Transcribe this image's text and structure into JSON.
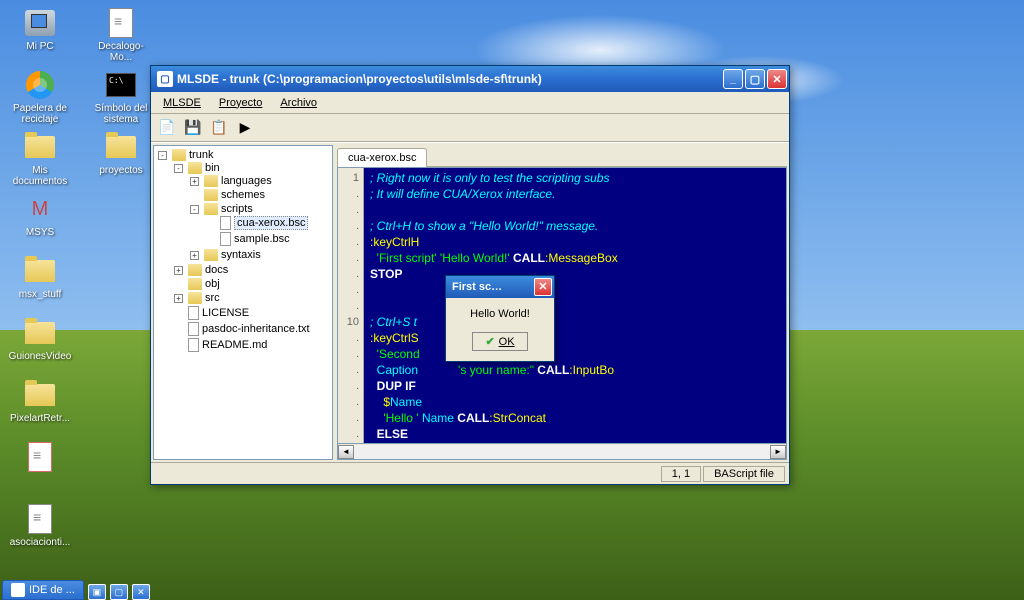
{
  "desktop": {
    "icons": [
      {
        "name": "mi-pc",
        "label": "Mi PC",
        "type": "pc"
      },
      {
        "name": "papelera",
        "label": "Papelera de reciclaje",
        "type": "recycle"
      },
      {
        "name": "mis-docs",
        "label": "Mis documentos",
        "type": "folder"
      },
      {
        "name": "msys",
        "label": "MSYS",
        "type": "app"
      },
      {
        "name": "msx-stuff",
        "label": "msx_stuff",
        "type": "folder"
      },
      {
        "name": "guiones",
        "label": "GuionesVideo",
        "type": "folder"
      },
      {
        "name": "pixelart",
        "label": "PixelartRetr...",
        "type": "folder"
      },
      {
        "name": "charla",
        "label": "",
        "type": "doc"
      },
      {
        "name": "asociacion",
        "label": "asociacionti...",
        "type": "doc"
      },
      {
        "name": "decalogo",
        "label": "Decalogo-Mo...",
        "type": "doc"
      },
      {
        "name": "simbolo",
        "label": "Símbolo del sistema",
        "type": "cmd"
      },
      {
        "name": "proyectos",
        "label": "proyectos",
        "type": "folder"
      }
    ]
  },
  "window": {
    "title": "MLSDE - trunk (C:\\programacion\\proyectos\\utils\\mlsde-sf\\trunk)",
    "menus": [
      "MLSDE",
      "Proyecto",
      "Archivo"
    ],
    "tree": {
      "root": "trunk",
      "bin": "bin",
      "languages": "languages",
      "schemes": "schemes",
      "scripts": "scripts",
      "cua": "cua-xerox.bsc",
      "sample": "sample.bsc",
      "syntaxis": "syntaxis",
      "docs": "docs",
      "obj": "obj",
      "src": "src",
      "license": "LICENSE",
      "pasdoc": "pasdoc-inheritance.txt",
      "readme": "README.md"
    },
    "tab": "cua-xerox.bsc",
    "gutter": {
      "l1": "1",
      "l10": "10"
    },
    "code": {
      "l1": "; Right now it is only to test the scripting subs",
      "l2": "; It will define CUA/Xerox interface.",
      "l3": "",
      "l4": "; Ctrl+H to show a \"Hello World!\" message.",
      "l5": ":keyCtrlH",
      "l6a": "  'First script'",
      "l6b": " 'Hello World!'",
      "l6c": " CALL",
      "l6d": ":MessageBox",
      "l7": "STOP",
      "l8": "",
      "l9": "",
      "l10a": "; Ctrl+S t",
      "l11": ":keyCtrlS",
      "l12a": "  'Second",
      "l12b": "ion",
      "l13a": "  Caption",
      "l13b": "'s your name:\"",
      "l13c": " CALL",
      "l13d": ":InputBo",
      "l14a": "  DUP",
      "l14b": " IF",
      "l15a": "    $",
      "l15b": "Name",
      "l16a": "    'Hello '",
      "l16b": " Name",
      "l16c": " CALL",
      "l16d": ":StrConcat",
      "l17": "  ELSE"
    },
    "status": {
      "pos": "1, 1",
      "type": "BAScript file"
    }
  },
  "dialog": {
    "title": "First sc…",
    "message": "Hello World!",
    "ok": "OK"
  },
  "taskbar": {
    "item": "IDE de ..."
  }
}
